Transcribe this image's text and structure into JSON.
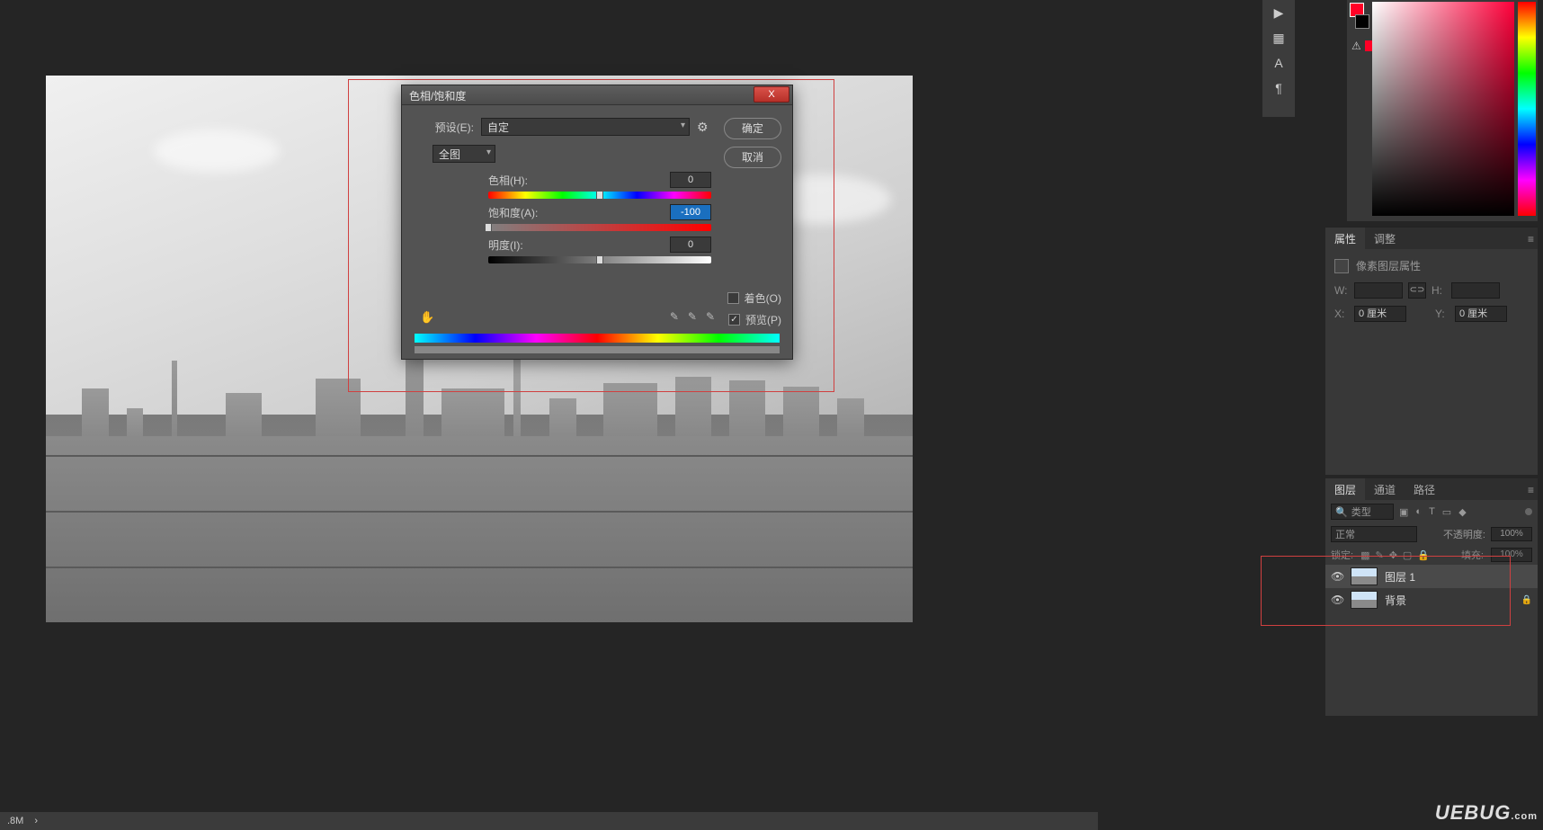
{
  "dialog": {
    "title": "色相/饱和度",
    "preset_label": "预设(E):",
    "preset_value": "自定",
    "master_value": "全图",
    "hue_label": "色相(H):",
    "hue_value": "0",
    "sat_label": "饱和度(A):",
    "sat_value": "-100",
    "light_label": "明度(I):",
    "light_value": "0",
    "colorize_label": "着色(O)",
    "preview_label": "预览(P)",
    "ok": "确定",
    "cancel": "取消",
    "close": "X"
  },
  "properties": {
    "tab1": "属性",
    "tab2": "调整",
    "kind": "像素图层属性",
    "w": "W:",
    "h": "H:",
    "x": "X:",
    "y": "Y:",
    "x_val": "0 厘米",
    "y_val": "0 厘米",
    "link": "⊂⊃"
  },
  "layers": {
    "tab1": "图层",
    "tab2": "通道",
    "tab3": "路径",
    "search": "类型",
    "blend": "正常",
    "opacity_label": "不透明度:",
    "opacity_val": "100%",
    "lock_label": "锁定:",
    "fill_label": "填充:",
    "fill_val": "100%",
    "items": [
      {
        "name": "图层 1",
        "locked": false
      },
      {
        "name": "背景",
        "locked": true
      }
    ]
  },
  "status": {
    "left": ".8M",
    "arrow": "›"
  },
  "watermark": {
    "main": "UEBUG",
    "sub": ".com"
  },
  "icons": {
    "play": "▶",
    "ruler": "▦",
    "text": "A",
    "para": "¶",
    "gear": "⚙",
    "warn": "⚠",
    "eye": "👁",
    "lock": "🔒",
    "hand": "✋",
    "dropper": "✎",
    "search": "🔍",
    "link": "⊂⊃",
    "menu": "≡",
    "img": "▣",
    "circle": "◐",
    "t": "T",
    "sq": "▭",
    "shape": "◆"
  }
}
